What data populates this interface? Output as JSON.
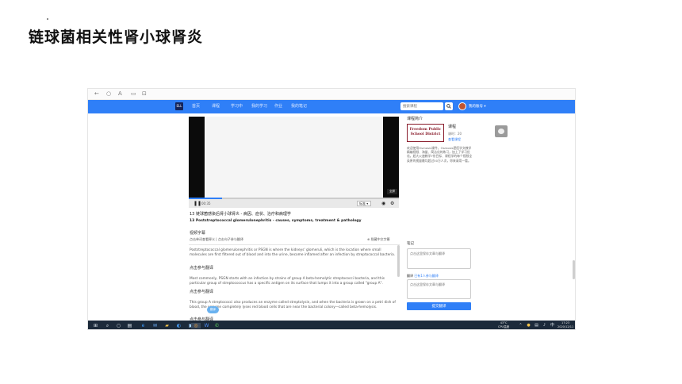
{
  "slide": {
    "title": "链球菌相关性肾小球肾炎"
  },
  "browser": {
    "back": "←",
    "refresh": "○",
    "home": "A",
    "tabs": "▭",
    "bookmark": "⊡"
  },
  "navbar": {
    "logo": "ELL",
    "items": [
      "首页",
      "课程",
      "学习中",
      "我的学习",
      "作业",
      "我的笔记"
    ],
    "search_placeholder": "搜索课程",
    "search_icon": "search-icon",
    "username": "我的账号"
  },
  "video": {
    "fullscreen_label": "全屏",
    "quality_label": "标准",
    "progress": 0.16,
    "time_label": "00:35",
    "play_icon": "pause-icon"
  },
  "lesson": {
    "title_cn": "13 链球菌感染后肾小球肾炎 - 病因、症状、治疗和病理学",
    "title_en": "13 Poststreptococcal glomerulonephritis - causes, symptoms, treatment & pathology"
  },
  "subtitles": {
    "heading": "视频字幕",
    "mode": "点击单词查看释义 | 点击句子参与翻译",
    "right_link": "⊕ 隐藏中文字幕",
    "paragraphs": [
      {
        "text": "Poststreptococcal glomerulonephritis or PSGN is where the kidneys' glomeruli, which is the location where small molecules are first filtered out of blood and into the urine, become inflamed after an infection by streptococcal bacteria.",
        "translate": "点击参与翻译"
      },
      {
        "text": "Most commonly, PSGN starts with an infection by strains of group A beta-hemolytic streptococci bacteria, and this particular group of streptococcus has a specific antigen on its surface that lumps it into a group called \"group A\".",
        "translate": "点击参与翻译"
      },
      {
        "text": "This group A streptococci also produces an enzyme called streptolysin, and when the bacteria is grown on a petri dish of blood, the enzyme completely lyses red blood cells that are near the bacterial colony—called beta-hemolysis.",
        "translate": "点击参与翻译"
      }
    ],
    "tooltip": "翻译"
  },
  "course": {
    "panel_title": "课程简介",
    "image_text": "Freedom Public School District",
    "name": "课程",
    "meta": "课时：20",
    "link": "查看课程",
    "description": "欢迎使用Osmosis课件，Osmosis是医学文教学精编视频、海量、简洁化的练习，加上了学习优化。超大火速教学7份目标、课程学的每个视频全英原的视量最均超过50万人次，你来请用一看。"
  },
  "note": {
    "label": "笔记",
    "placeholder": "点击这里保存文章与翻译"
  },
  "translate": {
    "label": "翻译",
    "link": "已有1人参与翻译",
    "placeholder": "点击这里保存文章与翻译",
    "submit": "提交翻译"
  },
  "taskbar": {
    "weather": "43°C\nCPU温度",
    "time": "17:23\n2020/12/11",
    "icons": [
      "windows-icon",
      "search-icon",
      "cortana-icon",
      "taskview-icon",
      "edge-icon",
      "mail-icon",
      "explorer-icon",
      "edge-browser-icon",
      "store-icon",
      "chrome-icon",
      "word-icon",
      "wechat-icon"
    ]
  }
}
